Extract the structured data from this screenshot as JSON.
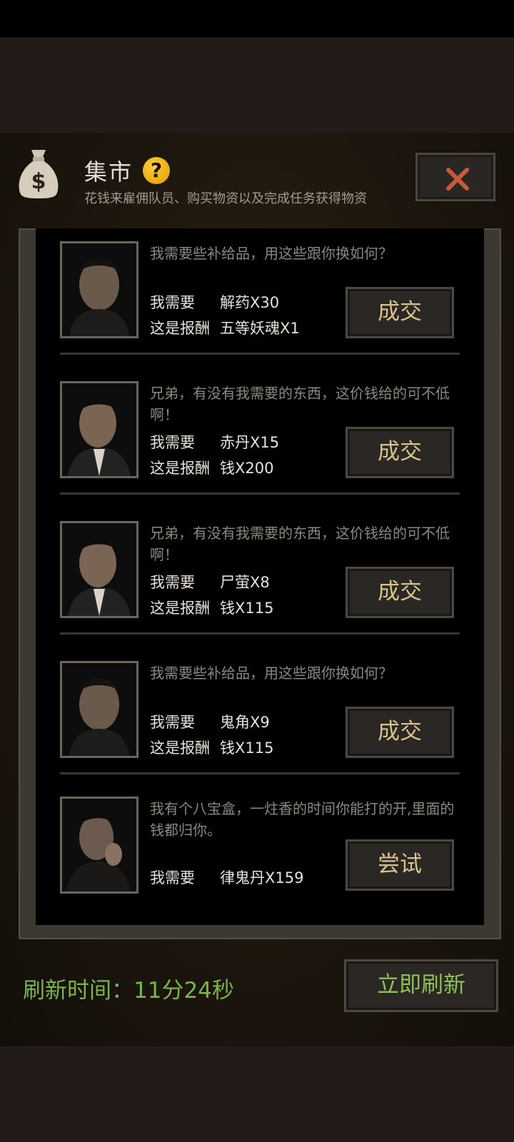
{
  "header": {
    "title": "集市",
    "help_glyph": "?",
    "subtitle": "花钱来雇佣队员、购买物资以及完成任务获得物资",
    "icons": [
      "money-bag-icon",
      "help-icon",
      "close-icon"
    ],
    "accent_color": "#c45a3a"
  },
  "offers": [
    {
      "message": "我需要些补给品，用这些跟你换如何？",
      "need_label": "我需要",
      "need_value": "解药X30",
      "reward_label": "这是报酬",
      "reward_value": "五等妖魂X1",
      "button": "成交"
    },
    {
      "message": "兄弟，有没有我需要的东西，这价钱给的可不低啊！",
      "need_label": "我需要",
      "need_value": "赤丹X15",
      "reward_label": "这是报酬",
      "reward_value": "钱X200",
      "button": "成交"
    },
    {
      "message": "兄弟，有没有我需要的东西，这价钱给的可不低啊！",
      "need_label": "我需要",
      "need_value": "尸萤X8",
      "reward_label": "这是报酬",
      "reward_value": "钱X115",
      "button": "成交"
    },
    {
      "message": "我需要些补给品，用这些跟你换如何？",
      "need_label": "我需要",
      "need_value": "鬼角X9",
      "reward_label": "这是报酬",
      "reward_value": "钱X115",
      "button": "成交"
    },
    {
      "message": "我有个八宝盒，一炷香的时间你能打的开,里面的钱都归你。",
      "need_label": "我需要",
      "need_value": "律鬼丹X159",
      "button": "尝试"
    }
  ],
  "footer": {
    "refresh_label": "刷新时间：11分24秒",
    "refresh_button": "立即刷新",
    "label_color": "#7ab44a"
  }
}
